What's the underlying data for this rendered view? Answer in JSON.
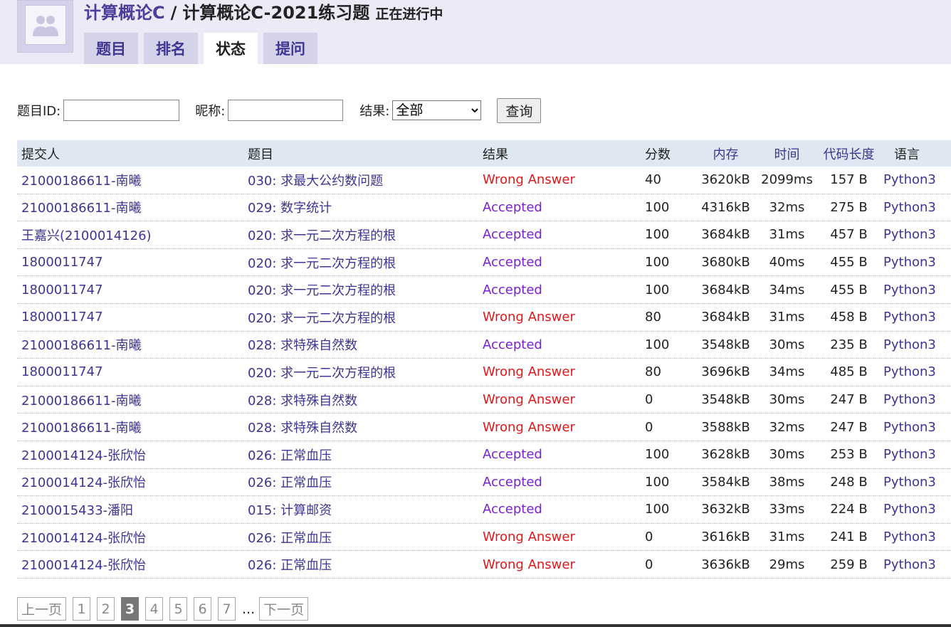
{
  "header": {
    "course": "计算概论C",
    "separator": "/",
    "contest": "计算概论C-2021练习题",
    "status": "正在进行中"
  },
  "tabs": [
    {
      "label": "题目",
      "active": false
    },
    {
      "label": "排名",
      "active": false
    },
    {
      "label": "状态",
      "active": true
    },
    {
      "label": "提问",
      "active": false
    }
  ],
  "filter": {
    "problem_id_label": "题目ID:",
    "problem_id_value": "",
    "nickname_label": "昵称:",
    "nickname_value": "",
    "result_label": "结果:",
    "result_selected": "全部",
    "query_button": "查询"
  },
  "table": {
    "headers": [
      "提交人",
      "题目",
      "结果",
      "分数",
      "内存",
      "时间",
      "代码长度",
      "语言"
    ],
    "rows": [
      {
        "user": "21000186611-南曦",
        "problem": "030: 求最大公约数问题",
        "result": "Wrong Answer",
        "score": "40",
        "memory": "3620kB",
        "time": "2099ms",
        "length": "157 B",
        "lang": "Python3"
      },
      {
        "user": "21000186611-南曦",
        "problem": "029: 数字统计",
        "result": "Accepted",
        "score": "100",
        "memory": "4316kB",
        "time": "32ms",
        "length": "275 B",
        "lang": "Python3"
      },
      {
        "user": "王嘉兴(2100014126)",
        "problem": "020: 求一元二次方程的根",
        "result": "Accepted",
        "score": "100",
        "memory": "3684kB",
        "time": "31ms",
        "length": "457 B",
        "lang": "Python3"
      },
      {
        "user": "1800011747",
        "problem": "020: 求一元二次方程的根",
        "result": "Accepted",
        "score": "100",
        "memory": "3680kB",
        "time": "40ms",
        "length": "455 B",
        "lang": "Python3"
      },
      {
        "user": "1800011747",
        "problem": "020: 求一元二次方程的根",
        "result": "Accepted",
        "score": "100",
        "memory": "3684kB",
        "time": "34ms",
        "length": "455 B",
        "lang": "Python3"
      },
      {
        "user": "1800011747",
        "problem": "020: 求一元二次方程的根",
        "result": "Wrong Answer",
        "score": "80",
        "memory": "3684kB",
        "time": "31ms",
        "length": "458 B",
        "lang": "Python3"
      },
      {
        "user": "21000186611-南曦",
        "problem": "028: 求特殊自然数",
        "result": "Accepted",
        "score": "100",
        "memory": "3548kB",
        "time": "30ms",
        "length": "235 B",
        "lang": "Python3"
      },
      {
        "user": "1800011747",
        "problem": "020: 求一元二次方程的根",
        "result": "Wrong Answer",
        "score": "80",
        "memory": "3696kB",
        "time": "34ms",
        "length": "485 B",
        "lang": "Python3"
      },
      {
        "user": "21000186611-南曦",
        "problem": "028: 求特殊自然数",
        "result": "Wrong Answer",
        "score": "0",
        "memory": "3548kB",
        "time": "30ms",
        "length": "247 B",
        "lang": "Python3"
      },
      {
        "user": "21000186611-南曦",
        "problem": "028: 求特殊自然数",
        "result": "Wrong Answer",
        "score": "0",
        "memory": "3588kB",
        "time": "32ms",
        "length": "247 B",
        "lang": "Python3"
      },
      {
        "user": "2100014124-张欣怡",
        "problem": "026: 正常血压",
        "result": "Accepted",
        "score": "100",
        "memory": "3628kB",
        "time": "30ms",
        "length": "253 B",
        "lang": "Python3"
      },
      {
        "user": "2100014124-张欣怡",
        "problem": "026: 正常血压",
        "result": "Accepted",
        "score": "100",
        "memory": "3584kB",
        "time": "38ms",
        "length": "248 B",
        "lang": "Python3"
      },
      {
        "user": "2100015433-潘阳",
        "problem": "015: 计算邮资",
        "result": "Accepted",
        "score": "100",
        "memory": "3632kB",
        "time": "33ms",
        "length": "224 B",
        "lang": "Python3"
      },
      {
        "user": "2100014124-张欣怡",
        "problem": "026: 正常血压",
        "result": "Wrong Answer",
        "score": "0",
        "memory": "3616kB",
        "time": "31ms",
        "length": "241 B",
        "lang": "Python3"
      },
      {
        "user": "2100014124-张欣怡",
        "problem": "026: 正常血压",
        "result": "Wrong Answer",
        "score": "0",
        "memory": "3636kB",
        "time": "29ms",
        "length": "259 B",
        "lang": "Python3"
      }
    ]
  },
  "pagination": {
    "prev": "上一页",
    "pages": [
      "1",
      "2",
      "3",
      "4",
      "5",
      "6",
      "7"
    ],
    "current": "3",
    "ellipsis": "...",
    "next": "下一页"
  },
  "colors": {
    "accepted": "#7a1fd6",
    "wrong_answer": "#e0181a",
    "link": "#3d3592",
    "header_bg": "#eceaf6"
  }
}
